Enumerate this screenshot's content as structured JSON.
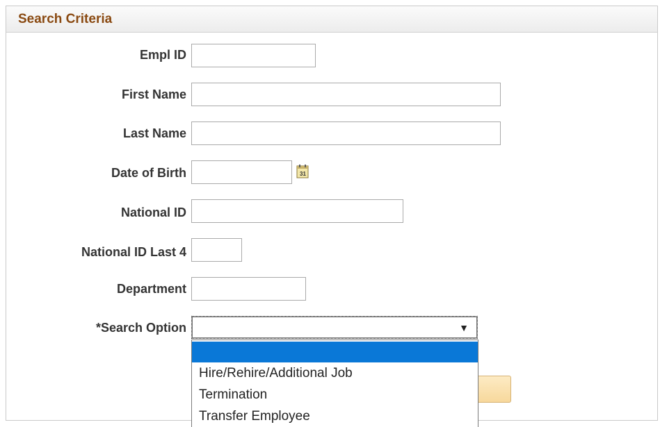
{
  "panel": {
    "title": "Search Criteria"
  },
  "fields": {
    "empl_id": {
      "label": "Empl ID",
      "value": ""
    },
    "first_name": {
      "label": "First Name",
      "value": ""
    },
    "last_name": {
      "label": "Last Name",
      "value": ""
    },
    "date_of_birth": {
      "label": "Date of Birth",
      "value": "",
      "icon": "calendar-icon"
    },
    "national_id": {
      "label": "National ID",
      "value": ""
    },
    "national_id_last4": {
      "label": "National ID Last 4",
      "value": ""
    },
    "department": {
      "label": "Department",
      "value": ""
    },
    "search_option": {
      "label": "*Search Option",
      "value": "",
      "arrow": "▼"
    }
  },
  "dropdown": {
    "options": [
      "",
      "Hire/Rehire/Additional Job",
      "Termination",
      "Transfer Employee"
    ]
  },
  "colors": {
    "title": "#8a4a12",
    "highlight": "#0a78d7",
    "button": "#f7d89c"
  }
}
